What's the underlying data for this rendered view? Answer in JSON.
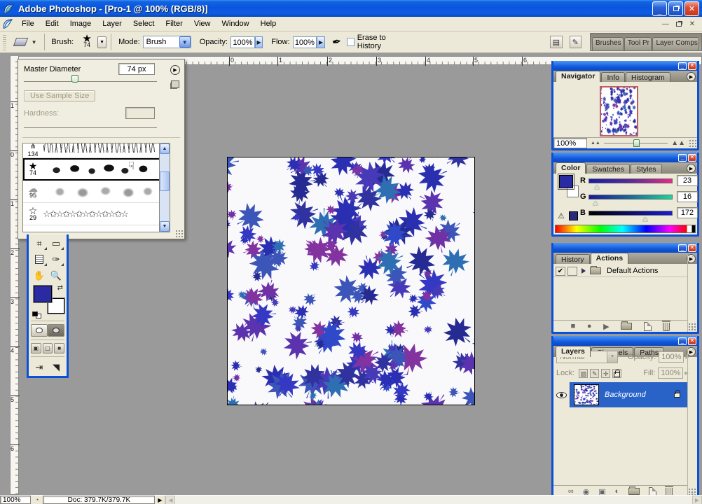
{
  "window": {
    "title": "Adobe Photoshop - [Pro-1 @ 100% (RGB/8)]"
  },
  "menu": {
    "items": [
      "File",
      "Edit",
      "Image",
      "Layer",
      "Select",
      "Filter",
      "View",
      "Window",
      "Help"
    ]
  },
  "options_bar": {
    "brush_label": "Brush:",
    "brush_size": "74",
    "mode_label": "Mode:",
    "mode_value": "Brush",
    "opacity_label": "Opacity:",
    "opacity_value": "100%",
    "flow_label": "Flow:",
    "flow_value": "100%",
    "erase_checkbox_label": "Erase to History",
    "palette_well_tabs": [
      "Brushes",
      "Tool Pr",
      "Layer Comps"
    ]
  },
  "brush_popup": {
    "master_diameter_label": "Master Diameter",
    "master_diameter_value": "74 px",
    "use_sample_size_label": "Use Sample Size",
    "hardness_label": "Hardness:",
    "brushes": [
      {
        "size": "134",
        "kind": "grass"
      },
      {
        "size": "74",
        "kind": "leaves",
        "selected": true
      },
      {
        "size": "95",
        "kind": "soft"
      },
      {
        "size": "29",
        "kind": "stars"
      }
    ],
    "stars_row_glyphs": "☆✩☆✩☆✩☆✩☆✩☆✩☆"
  },
  "ruler": {
    "horizontal_numbers": [
      "0",
      "1",
      "2",
      "3",
      "4",
      "5",
      "6"
    ],
    "vertical_numbers": [
      "1",
      "0",
      "1",
      "2",
      "3",
      "4",
      "5",
      "6"
    ]
  },
  "panels": {
    "navigator": {
      "tabs": [
        "Navigator",
        "Info",
        "Histogram"
      ],
      "zoom_value": "100%"
    },
    "color": {
      "tabs": [
        "Color",
        "Swatches",
        "Styles"
      ],
      "channels": [
        {
          "label": "R",
          "value": "23",
          "pos": 9
        },
        {
          "label": "G",
          "value": "16",
          "pos": 6
        },
        {
          "label": "B",
          "value": "172",
          "pos": 67
        }
      ]
    },
    "actions": {
      "tabs": [
        "History",
        "Actions"
      ],
      "check": "✔",
      "item_label": "Default Actions"
    },
    "layers": {
      "tabs": [
        "Layers",
        "Channels",
        "Paths"
      ],
      "blend_mode": "Normal",
      "opacity_label": "Opacity:",
      "opacity_value": "100%",
      "lock_label": "Lock:",
      "fill_label": "Fill:",
      "fill_value": "100%",
      "layer_name": "Background"
    }
  },
  "status_bar": {
    "zoom": "100%",
    "doc_info": "Doc: 379.7K/379.7K"
  },
  "canvas": {
    "background": "#f9f9fc",
    "leaf_count": 165,
    "seed": 11,
    "colors": [
      "#2a2fb0",
      "#3538c2",
      "#473ab9",
      "#5c33ae",
      "#6f31a4",
      "#8233a0",
      "#252b92",
      "#2f49c9",
      "#2e6fb3",
      "#3c55b8",
      "#2b2fb4",
      "#30329f"
    ]
  },
  "accent": {
    "xp_blue": "#0b50d8",
    "selection_blue": "#2a63c8",
    "thumb_border_red": "#c25d5d"
  }
}
